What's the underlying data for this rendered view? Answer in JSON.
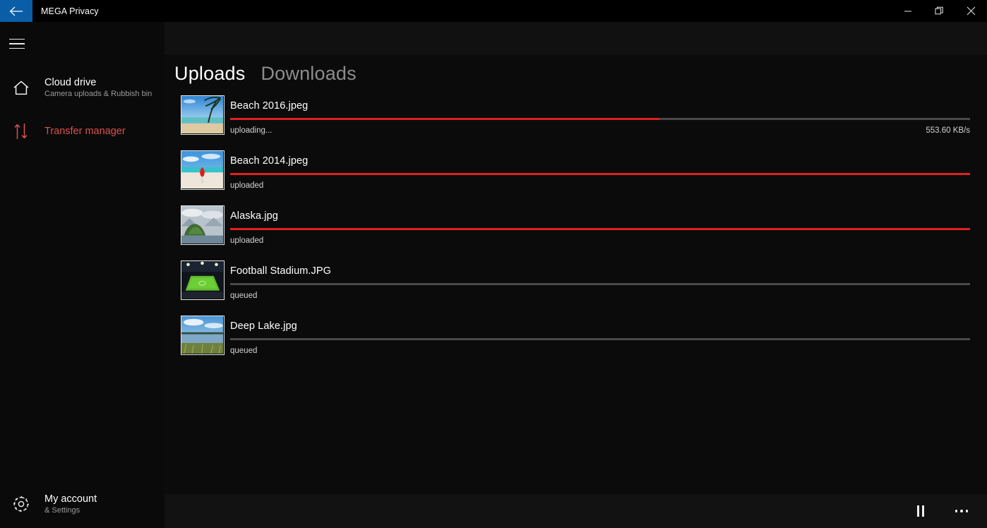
{
  "window": {
    "title": "MEGA Privacy",
    "back_icon": "back-arrow-icon",
    "minimize_label": "─",
    "maximize_label": "❐",
    "close_label": "✕"
  },
  "sidebar": {
    "menu_icon": "hamburger-menu-icon",
    "items": [
      {
        "id": "cloud-drive",
        "icon": "home-icon",
        "title": "Cloud drive",
        "subtitle": "Camera uploads & Rubbish bin",
        "active": false
      },
      {
        "id": "transfer-manager",
        "icon": "transfer-arrows-icon",
        "title": "Transfer manager",
        "subtitle": "",
        "active": true
      }
    ],
    "account": {
      "icon": "gear-icon",
      "title": "My account",
      "subtitle": "& Settings"
    }
  },
  "main": {
    "tabs": [
      {
        "label": "Uploads",
        "active": true
      },
      {
        "label": "Downloads",
        "active": false
      }
    ],
    "transfers": [
      {
        "name": "Beach 2016.jpeg",
        "status": "uploading...",
        "speed": "553.60 KB/s",
        "progress": 58,
        "thumb": "beach-palm-thumbnail"
      },
      {
        "name": "Beach 2014.jpeg",
        "status": "uploaded",
        "speed": "",
        "progress": 100,
        "thumb": "beach-umbrella-thumbnail"
      },
      {
        "name": "Alaska.jpg",
        "status": "uploaded",
        "speed": "",
        "progress": 100,
        "thumb": "alaska-island-thumbnail"
      },
      {
        "name": "Football Stadium.JPG",
        "status": "queued",
        "speed": "",
        "progress": 0,
        "thumb": "stadium-thumbnail"
      },
      {
        "name": "Deep Lake.jpg",
        "status": "queued",
        "speed": "",
        "progress": 0,
        "thumb": "lake-thumbnail"
      }
    ]
  },
  "commandbar": {
    "pause_icon": "pause-icon",
    "more_icon": "more-options-icon"
  },
  "colors": {
    "accent_red": "#e02020",
    "accent_blue": "#0a5ea8",
    "track_gray": "#4a4a4a",
    "panel_bg": "#0b0b0b"
  }
}
